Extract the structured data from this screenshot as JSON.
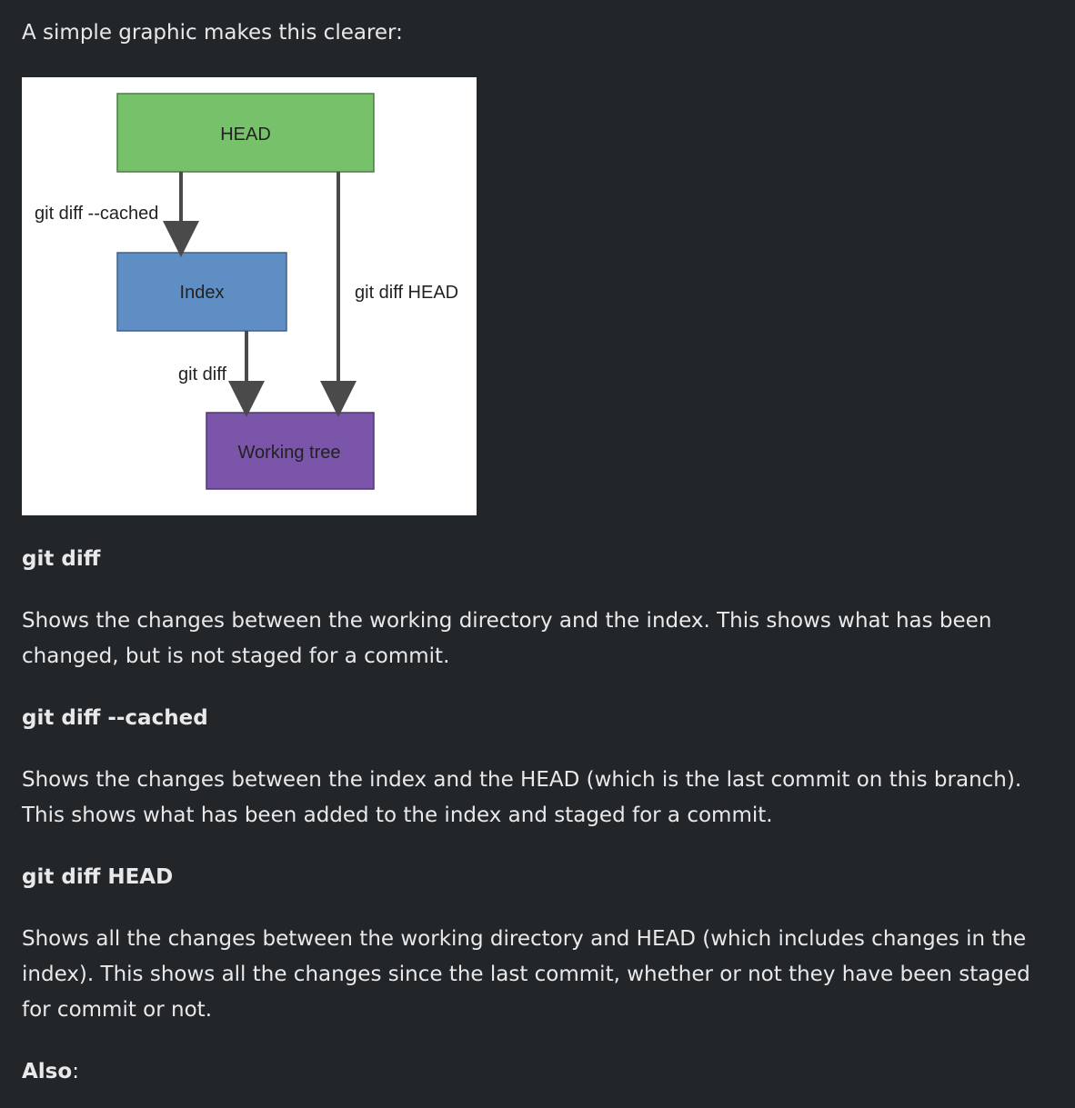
{
  "intro": "A simple graphic makes this clearer:",
  "diagram": {
    "head_label": "HEAD",
    "index_label": "Index",
    "working_tree_label": "Working tree",
    "cached_label": "git diff --cached",
    "diff_label": "git diff",
    "diff_head_label": "git diff HEAD",
    "colors": {
      "head": "#77c16a",
      "index": "#5f8ec4",
      "working_tree": "#7a55a9",
      "arrow": "#4a4a4a"
    }
  },
  "sections": [
    {
      "title": "git diff",
      "description": "Shows the changes between the working directory and the index. This shows what has been changed, but is not staged for a commit."
    },
    {
      "title": "git diff --cached",
      "description": "Shows the changes between the index and the HEAD (which is the last commit on this branch). This shows what has been added to the index and staged for a commit."
    },
    {
      "title": "git diff HEAD",
      "description": "Shows all the changes between the working directory and HEAD (which includes changes in the index). This shows all the changes since the last commit, whether or not they have been staged for commit or not."
    }
  ],
  "also": {
    "bold": "Also",
    "suffix": ":"
  }
}
